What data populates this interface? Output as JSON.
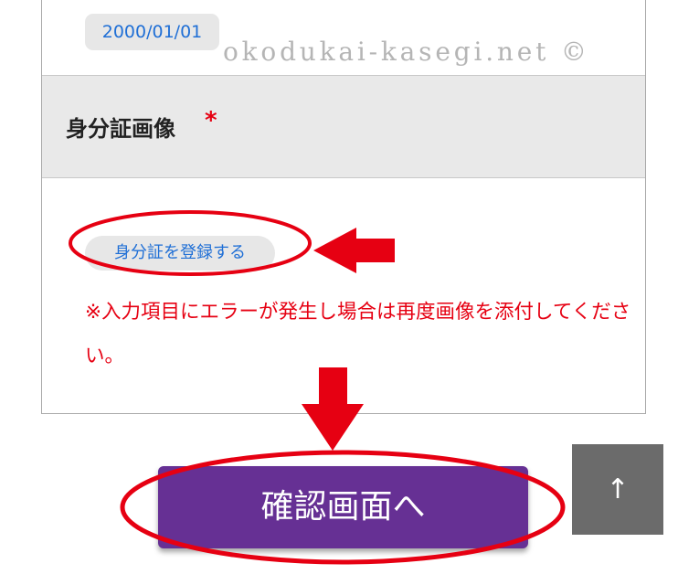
{
  "birthdate": {
    "value": "2000/01/01"
  },
  "watermark": {
    "text": "okodukai-kasegi.net ©"
  },
  "id_section": {
    "label": "身分証画像",
    "required_mark": "*",
    "register_button": "身分証を登録する",
    "note": "※入力項目にエラーが発生し場合は再度画像を添付してください。"
  },
  "confirm_button": {
    "label": "確認画面へ"
  },
  "scroll_top": {
    "icon": "arrow-up-icon",
    "glyph": "↑"
  },
  "annotation_color": "#e60012",
  "button_color": "#663094"
}
